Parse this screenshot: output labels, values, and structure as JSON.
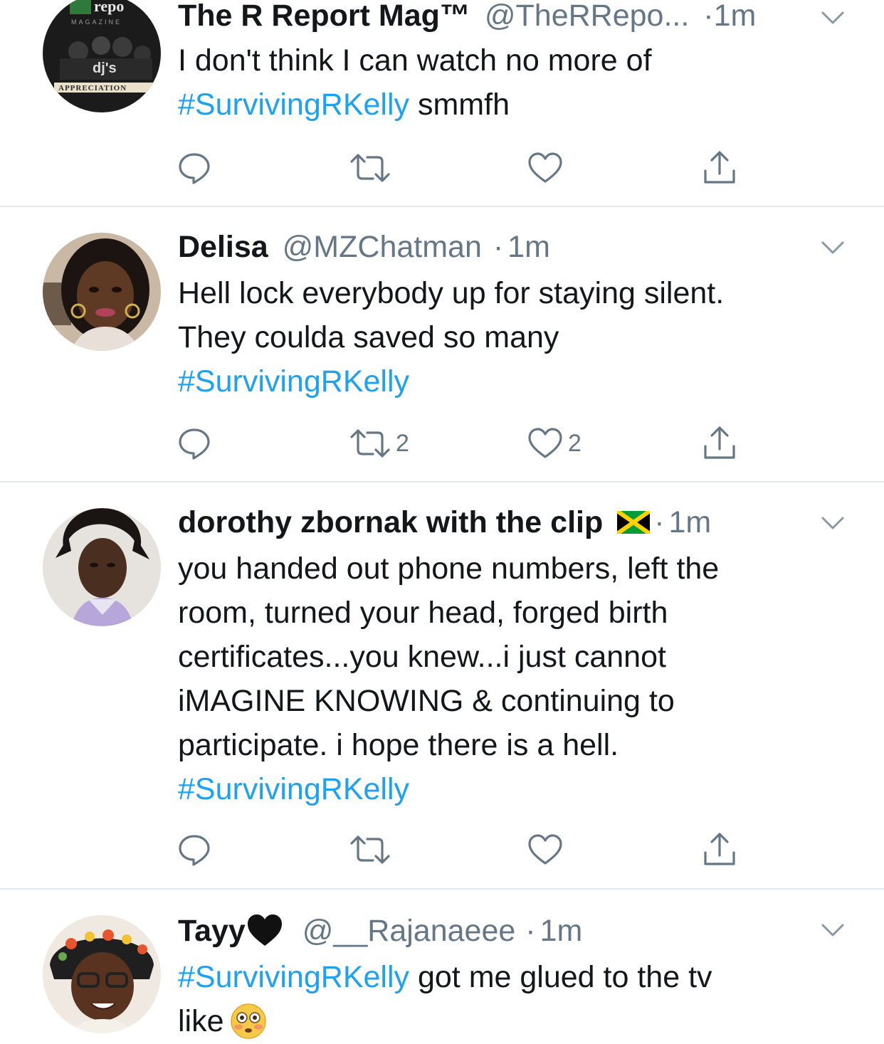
{
  "tweets": [
    {
      "name": "The R Report Mag™",
      "handle": "@TheRRepo...",
      "dot": "·",
      "time": "1m",
      "avatar_lines": [
        "repo",
        "MAGAZINE",
        "dj's",
        "APPRECIATION"
      ],
      "lines": [
        [
          "I don't think I can watch no more of"
        ],
        [
          "#SurvivingRKelly",
          " smmfh"
        ]
      ],
      "retweets": "",
      "likes": ""
    },
    {
      "name": "Delisa",
      "handle": "@MZChatman",
      "dot": "·",
      "time": "1m",
      "lines": [
        [
          "Hell lock everybody up for staying silent."
        ],
        [
          "They coulda saved so many"
        ],
        [
          "#SurvivingRKelly"
        ]
      ],
      "retweets": "2",
      "likes": "2"
    },
    {
      "name": "dorothy zbornak with the clip",
      "handle": "",
      "dot": "·",
      "time": "1m",
      "lines": [
        [
          "you handed out phone numbers, left the"
        ],
        [
          "room, turned your head, forged birth"
        ],
        [
          "certificates...you knew...i just cannot"
        ],
        [
          "iMAGINE KNOWING & continuing to"
        ],
        [
          "participate. i hope there is a hell."
        ],
        [
          "#SurvivingRKelly"
        ]
      ],
      "retweets": "",
      "likes": ""
    },
    {
      "name": "Tayy",
      "handle": "@__Rajanaeee",
      "dot": "·",
      "time": "1m",
      "lines": [
        [
          "#SurvivingRKelly",
          " got me glued to the tv"
        ],
        [
          "like"
        ]
      ],
      "retweets": "",
      "likes": ""
    }
  ],
  "colors": {
    "link": "#1da1f2",
    "muted": "#657786",
    "text": "#14171a",
    "divider": "#e1e8ed"
  }
}
